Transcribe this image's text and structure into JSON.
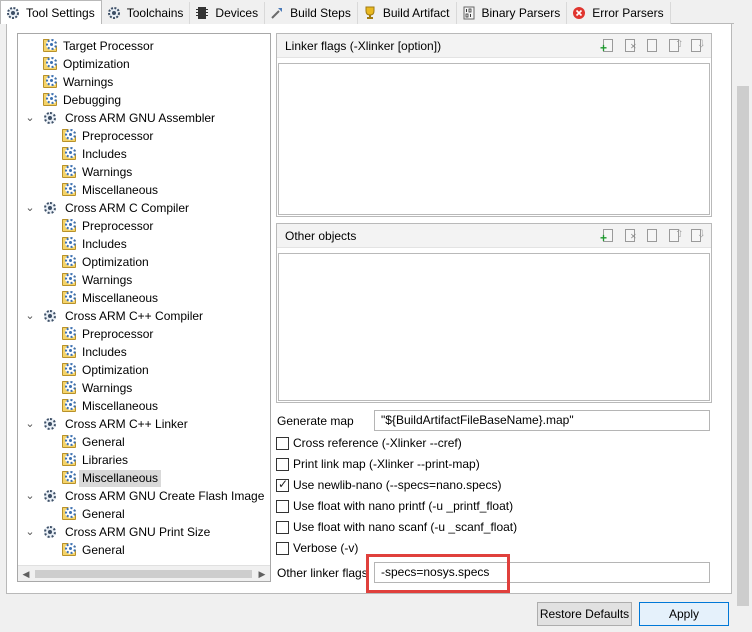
{
  "tabs": [
    {
      "label": "Tool Settings",
      "icon": "gear-icon",
      "active": true
    },
    {
      "label": "Toolchains",
      "icon": "toolchain-icon",
      "active": false
    },
    {
      "label": "Devices",
      "icon": "device-chip-icon",
      "active": false
    },
    {
      "label": "Build Steps",
      "icon": "build-steps-icon",
      "active": false
    },
    {
      "label": "Build Artifact",
      "icon": "trophy-icon",
      "active": false
    },
    {
      "label": "Binary Parsers",
      "icon": "binary-icon",
      "active": false
    },
    {
      "label": "Error Parsers",
      "icon": "error-icon",
      "active": false
    }
  ],
  "tree": {
    "items": [
      {
        "label": "Target Processor",
        "level": 1,
        "kind": "folder"
      },
      {
        "label": "Optimization",
        "level": 1,
        "kind": "folder"
      },
      {
        "label": "Warnings",
        "level": 1,
        "kind": "folder"
      },
      {
        "label": "Debugging",
        "level": 1,
        "kind": "folder"
      },
      {
        "label": "Cross ARM GNU Assembler",
        "level": 0,
        "kind": "tool"
      },
      {
        "label": "Preprocessor",
        "level": 2,
        "kind": "folder"
      },
      {
        "label": "Includes",
        "level": 2,
        "kind": "folder"
      },
      {
        "label": "Warnings",
        "level": 2,
        "kind": "folder"
      },
      {
        "label": "Miscellaneous",
        "level": 2,
        "kind": "folder"
      },
      {
        "label": "Cross ARM C Compiler",
        "level": 0,
        "kind": "tool"
      },
      {
        "label": "Preprocessor",
        "level": 2,
        "kind": "folder"
      },
      {
        "label": "Includes",
        "level": 2,
        "kind": "folder"
      },
      {
        "label": "Optimization",
        "level": 2,
        "kind": "folder"
      },
      {
        "label": "Warnings",
        "level": 2,
        "kind": "folder"
      },
      {
        "label": "Miscellaneous",
        "level": 2,
        "kind": "folder"
      },
      {
        "label": "Cross ARM C++ Compiler",
        "level": 0,
        "kind": "tool"
      },
      {
        "label": "Preprocessor",
        "level": 2,
        "kind": "folder"
      },
      {
        "label": "Includes",
        "level": 2,
        "kind": "folder"
      },
      {
        "label": "Optimization",
        "level": 2,
        "kind": "folder"
      },
      {
        "label": "Warnings",
        "level": 2,
        "kind": "folder"
      },
      {
        "label": "Miscellaneous",
        "level": 2,
        "kind": "folder"
      },
      {
        "label": "Cross ARM C++ Linker",
        "level": 0,
        "kind": "tool"
      },
      {
        "label": "General",
        "level": 2,
        "kind": "folder"
      },
      {
        "label": "Libraries",
        "level": 2,
        "kind": "folder"
      },
      {
        "label": "Miscellaneous",
        "level": 2,
        "kind": "folder",
        "selected": true
      },
      {
        "label": "Cross ARM GNU Create Flash Image",
        "level": 0,
        "kind": "tool"
      },
      {
        "label": "General",
        "level": 2,
        "kind": "folder"
      },
      {
        "label": "Cross ARM GNU Print Size",
        "level": 0,
        "kind": "tool"
      },
      {
        "label": "General",
        "level": 2,
        "kind": "folder"
      }
    ]
  },
  "linker_flags": {
    "title": "Linker flags (-Xlinker [option])"
  },
  "other_objects": {
    "title": "Other objects"
  },
  "generate_map": {
    "label": "Generate map",
    "value": "\"${BuildArtifactFileBaseName}.map\""
  },
  "options": [
    {
      "label": "Cross reference (-Xlinker --cref)",
      "checked": false
    },
    {
      "label": "Print link map (-Xlinker --print-map)",
      "checked": false
    },
    {
      "label": "Use newlib-nano (--specs=nano.specs)",
      "checked": true
    },
    {
      "label": "Use float with nano printf (-u _printf_float)",
      "checked": false
    },
    {
      "label": "Use float with nano scanf (-u _scanf_float)",
      "checked": false
    },
    {
      "label": "Verbose (-v)",
      "checked": false
    }
  ],
  "other_linker_flags": {
    "label": "Other linker flags",
    "value": "-specs=nosys.specs"
  },
  "buttons": {
    "restore": "Restore Defaults",
    "apply": "Apply"
  },
  "colors": {
    "highlight": "#e0403c",
    "selection": "#d9d9d9",
    "apply_border": "#0078d7"
  }
}
